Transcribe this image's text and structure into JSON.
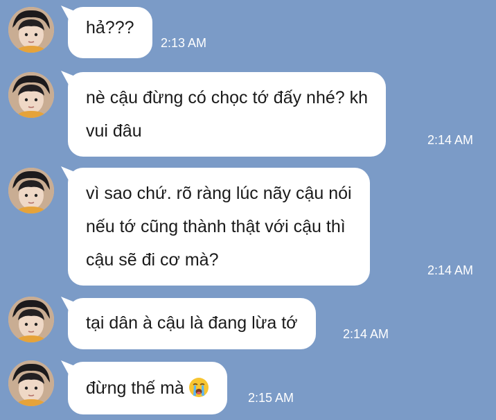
{
  "messages": [
    {
      "lines": [
        "hả???"
      ],
      "time": "2:13 AM",
      "emoji": ""
    },
    {
      "lines": [
        "nè cậu đừng có chọc tớ đấy nhé? kh",
        "vui đâu"
      ],
      "time": "2:14 AM",
      "emoji": ""
    },
    {
      "lines": [
        "vì sao chứ. rõ ràng lúc nãy cậu nói",
        "nếu tớ cũng thành thật với cậu thì",
        "cậu sẽ đi cơ mà?"
      ],
      "time": "2:14 AM",
      "emoji": ""
    },
    {
      "lines": [
        "tại dân à cậu là đang lừa tớ"
      ],
      "time": "2:14 AM",
      "emoji": ""
    },
    {
      "lines": [
        "đừng thế mà"
      ],
      "time": "2:15 AM",
      "emoji": "loudly-crying-face"
    }
  ]
}
